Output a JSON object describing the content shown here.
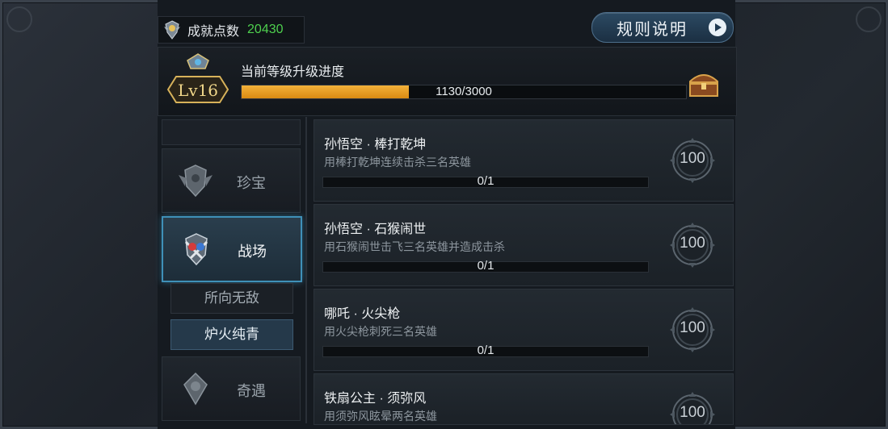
{
  "top": {
    "points_label": "成就点数",
    "points_value": "20430",
    "rules_button": "规则说明"
  },
  "level": {
    "badge": "Lv16",
    "title": "当前等级升级进度",
    "current": 1130,
    "max": 3000,
    "progress_text": "1130/3000"
  },
  "menu": {
    "items": [
      {
        "label": "珍宝",
        "icon": "treasure-emblem-icon"
      },
      {
        "label": "战场",
        "icon": "battlefield-emblem-icon"
      },
      {
        "label": "奇遇",
        "icon": "adventure-emblem-icon"
      }
    ],
    "subitems": [
      {
        "label": "所向无敌"
      },
      {
        "label": "炉火纯青"
      }
    ]
  },
  "achievements": [
    {
      "name": "孙悟空 · 棒打乾坤",
      "desc": "用棒打乾坤连续击杀三名英雄",
      "progress": "0/1",
      "points": "100"
    },
    {
      "name": "孙悟空 · 石猴闹世",
      "desc": "用石猴闹世击飞三名英雄并造成击杀",
      "progress": "0/1",
      "points": "100"
    },
    {
      "name": "哪吒 · 火尖枪",
      "desc": "用火尖枪刺死三名英雄",
      "progress": "0/1",
      "points": "100"
    },
    {
      "name": "铁扇公主 · 须弥风",
      "desc": "用须弥风眩晕两名英雄",
      "progress": "",
      "points": "100"
    }
  ],
  "colors": {
    "accent_green": "#4ed04e",
    "progress_orange": "#e9a02a",
    "active_border": "#3f90b8"
  }
}
